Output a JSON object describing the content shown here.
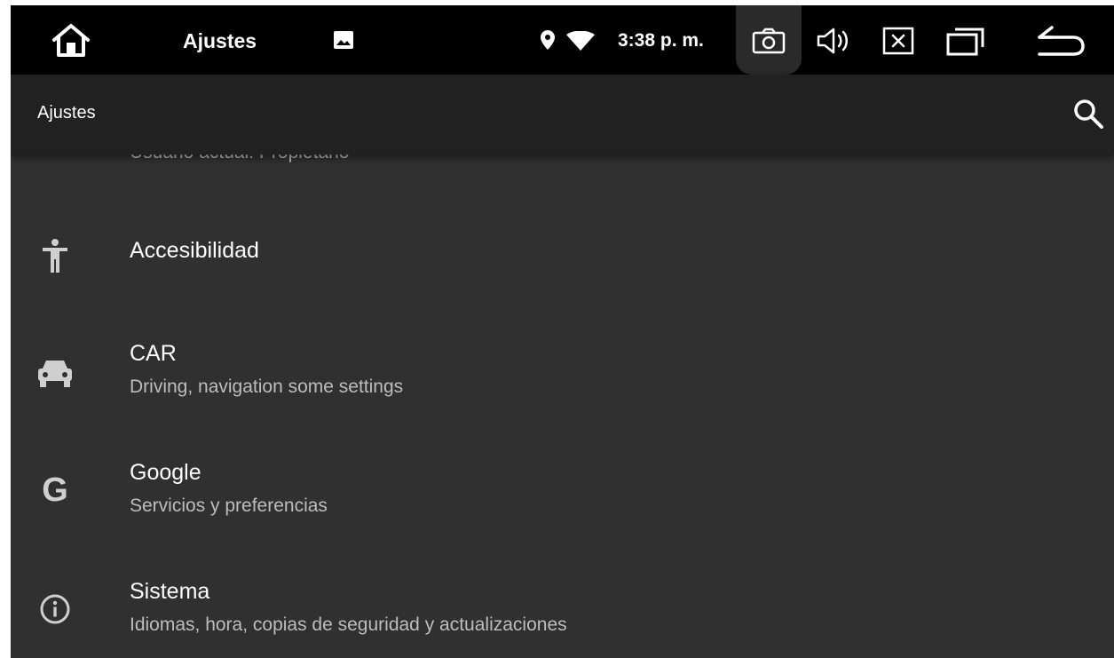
{
  "statusbar": {
    "app_title": "Ajustes",
    "time": "3:38 p. m.",
    "icons": [
      "home-icon",
      "image-icon",
      "location-icon",
      "wifi-icon",
      "camera-icon",
      "volume-icon",
      "close-icon",
      "recents-icon",
      "back-icon"
    ]
  },
  "toolbar": {
    "title": "Ajustes",
    "search_icon": "search-icon"
  },
  "list": {
    "partial_subtitle": "Usuario actual: Propietario",
    "items": [
      {
        "title": "Accesibilidad",
        "subtitle": "",
        "icon": "accessibility-icon"
      },
      {
        "title": "CAR",
        "subtitle": "Driving, navigation some settings",
        "icon": "car-icon"
      },
      {
        "title": "Google",
        "subtitle": "Servicios y preferencias",
        "icon": "google-icon",
        "glyph": "G"
      },
      {
        "title": "Sistema",
        "subtitle": "Idiomas, hora, copias de seguridad y actualizaciones",
        "icon": "info-icon"
      }
    ]
  },
  "colors": {
    "system_bar": "#000000",
    "toolbar": "#212121",
    "background": "#303030",
    "primary_text": "#ffffff",
    "secondary_text": "#bdbdbd"
  }
}
